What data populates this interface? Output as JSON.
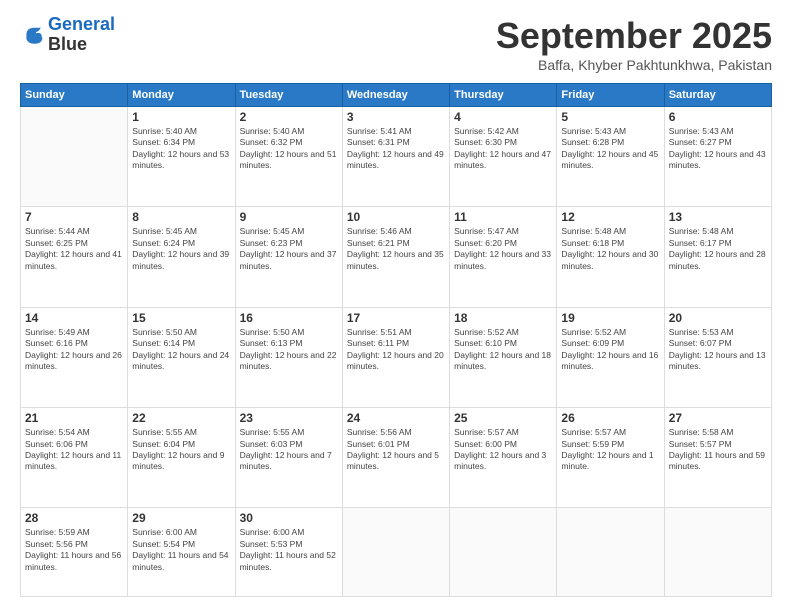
{
  "header": {
    "logo_line1": "General",
    "logo_line2": "Blue",
    "month_title": "September 2025",
    "subtitle": "Baffa, Khyber Pakhtunkhwa, Pakistan"
  },
  "weekdays": [
    "Sunday",
    "Monday",
    "Tuesday",
    "Wednesday",
    "Thursday",
    "Friday",
    "Saturday"
  ],
  "weeks": [
    [
      {
        "day": null
      },
      {
        "day": "1",
        "sunrise": "Sunrise: 5:40 AM",
        "sunset": "Sunset: 6:34 PM",
        "daylight": "Daylight: 12 hours and 53 minutes."
      },
      {
        "day": "2",
        "sunrise": "Sunrise: 5:40 AM",
        "sunset": "Sunset: 6:32 PM",
        "daylight": "Daylight: 12 hours and 51 minutes."
      },
      {
        "day": "3",
        "sunrise": "Sunrise: 5:41 AM",
        "sunset": "Sunset: 6:31 PM",
        "daylight": "Daylight: 12 hours and 49 minutes."
      },
      {
        "day": "4",
        "sunrise": "Sunrise: 5:42 AM",
        "sunset": "Sunset: 6:30 PM",
        "daylight": "Daylight: 12 hours and 47 minutes."
      },
      {
        "day": "5",
        "sunrise": "Sunrise: 5:43 AM",
        "sunset": "Sunset: 6:28 PM",
        "daylight": "Daylight: 12 hours and 45 minutes."
      },
      {
        "day": "6",
        "sunrise": "Sunrise: 5:43 AM",
        "sunset": "Sunset: 6:27 PM",
        "daylight": "Daylight: 12 hours and 43 minutes."
      }
    ],
    [
      {
        "day": "7",
        "sunrise": "Sunrise: 5:44 AM",
        "sunset": "Sunset: 6:25 PM",
        "daylight": "Daylight: 12 hours and 41 minutes."
      },
      {
        "day": "8",
        "sunrise": "Sunrise: 5:45 AM",
        "sunset": "Sunset: 6:24 PM",
        "daylight": "Daylight: 12 hours and 39 minutes."
      },
      {
        "day": "9",
        "sunrise": "Sunrise: 5:45 AM",
        "sunset": "Sunset: 6:23 PM",
        "daylight": "Daylight: 12 hours and 37 minutes."
      },
      {
        "day": "10",
        "sunrise": "Sunrise: 5:46 AM",
        "sunset": "Sunset: 6:21 PM",
        "daylight": "Daylight: 12 hours and 35 minutes."
      },
      {
        "day": "11",
        "sunrise": "Sunrise: 5:47 AM",
        "sunset": "Sunset: 6:20 PM",
        "daylight": "Daylight: 12 hours and 33 minutes."
      },
      {
        "day": "12",
        "sunrise": "Sunrise: 5:48 AM",
        "sunset": "Sunset: 6:18 PM",
        "daylight": "Daylight: 12 hours and 30 minutes."
      },
      {
        "day": "13",
        "sunrise": "Sunrise: 5:48 AM",
        "sunset": "Sunset: 6:17 PM",
        "daylight": "Daylight: 12 hours and 28 minutes."
      }
    ],
    [
      {
        "day": "14",
        "sunrise": "Sunrise: 5:49 AM",
        "sunset": "Sunset: 6:16 PM",
        "daylight": "Daylight: 12 hours and 26 minutes."
      },
      {
        "day": "15",
        "sunrise": "Sunrise: 5:50 AM",
        "sunset": "Sunset: 6:14 PM",
        "daylight": "Daylight: 12 hours and 24 minutes."
      },
      {
        "day": "16",
        "sunrise": "Sunrise: 5:50 AM",
        "sunset": "Sunset: 6:13 PM",
        "daylight": "Daylight: 12 hours and 22 minutes."
      },
      {
        "day": "17",
        "sunrise": "Sunrise: 5:51 AM",
        "sunset": "Sunset: 6:11 PM",
        "daylight": "Daylight: 12 hours and 20 minutes."
      },
      {
        "day": "18",
        "sunrise": "Sunrise: 5:52 AM",
        "sunset": "Sunset: 6:10 PM",
        "daylight": "Daylight: 12 hours and 18 minutes."
      },
      {
        "day": "19",
        "sunrise": "Sunrise: 5:52 AM",
        "sunset": "Sunset: 6:09 PM",
        "daylight": "Daylight: 12 hours and 16 minutes."
      },
      {
        "day": "20",
        "sunrise": "Sunrise: 5:53 AM",
        "sunset": "Sunset: 6:07 PM",
        "daylight": "Daylight: 12 hours and 13 minutes."
      }
    ],
    [
      {
        "day": "21",
        "sunrise": "Sunrise: 5:54 AM",
        "sunset": "Sunset: 6:06 PM",
        "daylight": "Daylight: 12 hours and 11 minutes."
      },
      {
        "day": "22",
        "sunrise": "Sunrise: 5:55 AM",
        "sunset": "Sunset: 6:04 PM",
        "daylight": "Daylight: 12 hours and 9 minutes."
      },
      {
        "day": "23",
        "sunrise": "Sunrise: 5:55 AM",
        "sunset": "Sunset: 6:03 PM",
        "daylight": "Daylight: 12 hours and 7 minutes."
      },
      {
        "day": "24",
        "sunrise": "Sunrise: 5:56 AM",
        "sunset": "Sunset: 6:01 PM",
        "daylight": "Daylight: 12 hours and 5 minutes."
      },
      {
        "day": "25",
        "sunrise": "Sunrise: 5:57 AM",
        "sunset": "Sunset: 6:00 PM",
        "daylight": "Daylight: 12 hours and 3 minutes."
      },
      {
        "day": "26",
        "sunrise": "Sunrise: 5:57 AM",
        "sunset": "Sunset: 5:59 PM",
        "daylight": "Daylight: 12 hours and 1 minute."
      },
      {
        "day": "27",
        "sunrise": "Sunrise: 5:58 AM",
        "sunset": "Sunset: 5:57 PM",
        "daylight": "Daylight: 11 hours and 59 minutes."
      }
    ],
    [
      {
        "day": "28",
        "sunrise": "Sunrise: 5:59 AM",
        "sunset": "Sunset: 5:56 PM",
        "daylight": "Daylight: 11 hours and 56 minutes."
      },
      {
        "day": "29",
        "sunrise": "Sunrise: 6:00 AM",
        "sunset": "Sunset: 5:54 PM",
        "daylight": "Daylight: 11 hours and 54 minutes."
      },
      {
        "day": "30",
        "sunrise": "Sunrise: 6:00 AM",
        "sunset": "Sunset: 5:53 PM",
        "daylight": "Daylight: 11 hours and 52 minutes."
      },
      {
        "day": null
      },
      {
        "day": null
      },
      {
        "day": null
      },
      {
        "day": null
      }
    ]
  ]
}
